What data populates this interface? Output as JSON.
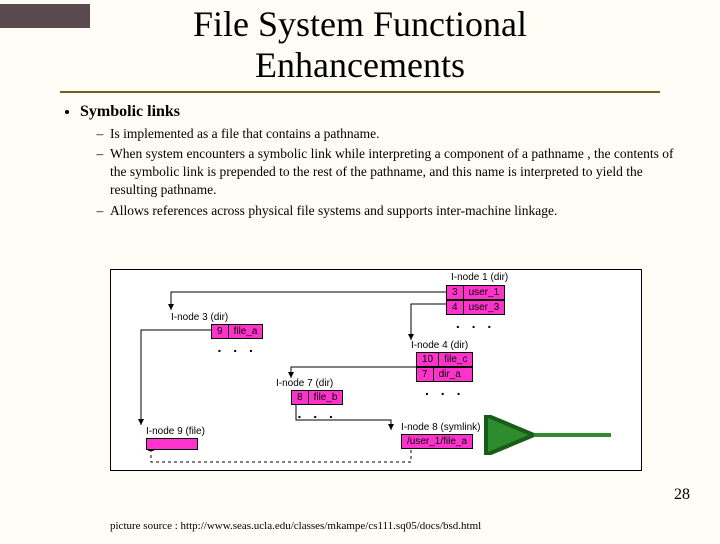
{
  "title_line1": "File System Functional",
  "title_line2": "Enhancements",
  "heading": "Symbolic links",
  "bullets": [
    "Is implemented as a file that contains a pathname.",
    "When system encounters a symbolic link while interpreting a component of a pathname , the contents of the symbolic link is prepended to the rest of the pathname, and this name is interpreted to yield the resulting pathname.",
    "Allows references across physical file systems and supports inter-machine linkage."
  ],
  "diagram": {
    "inode1": {
      "label": "I-node 1 (dir)",
      "rows": [
        [
          "3",
          "user_1"
        ],
        [
          "4",
          "user_3"
        ]
      ]
    },
    "inode3": {
      "label": "I-node 3 (dir)",
      "rows": [
        [
          "9",
          "file_a"
        ]
      ]
    },
    "inode4": {
      "label": "I-node 4 (dir)",
      "rows": [
        [
          "10",
          "file_c"
        ],
        [
          "7",
          "dir_a"
        ]
      ]
    },
    "inode7": {
      "label": "I-node 7 (dir)",
      "rows": [
        [
          "8",
          "file_b"
        ]
      ]
    },
    "inode8": {
      "label": "I-node 8 (symlink)",
      "content": "/user_1/file_a"
    },
    "inode9": {
      "label": "I-node 9 (file)"
    },
    "dots": ". . ."
  },
  "page_number": "28",
  "footer": "picture source : http://www.seas.ucla.edu/classes/mkampe/cs111.sq05/docs/bsd.html"
}
